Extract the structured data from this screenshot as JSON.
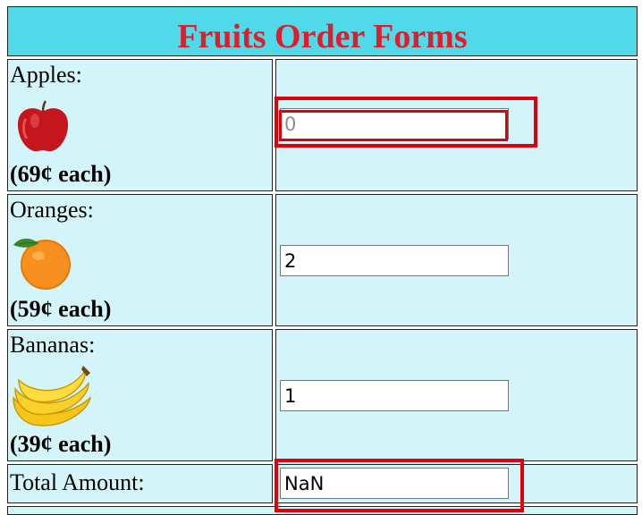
{
  "form": {
    "title": "Fruits Order Forms",
    "items": [
      {
        "label": "Apples:",
        "price": "(69¢ each)",
        "quantity": "",
        "placeholder": "0",
        "icon": "apple-icon"
      },
      {
        "label": "Oranges:",
        "price": "(59¢ each)",
        "quantity": "2",
        "icon": "orange-icon"
      },
      {
        "label": "Bananas:",
        "price": "(39¢ each)",
        "quantity": "1",
        "icon": "banana-icon"
      }
    ],
    "total": {
      "label": "Total Amount:",
      "value": "NaN"
    }
  },
  "colors": {
    "title_bg": "#4fd9e9",
    "title_text": "#e21d2b",
    "cell_bg": "#d3f5f9",
    "highlight": "#e0000a"
  }
}
